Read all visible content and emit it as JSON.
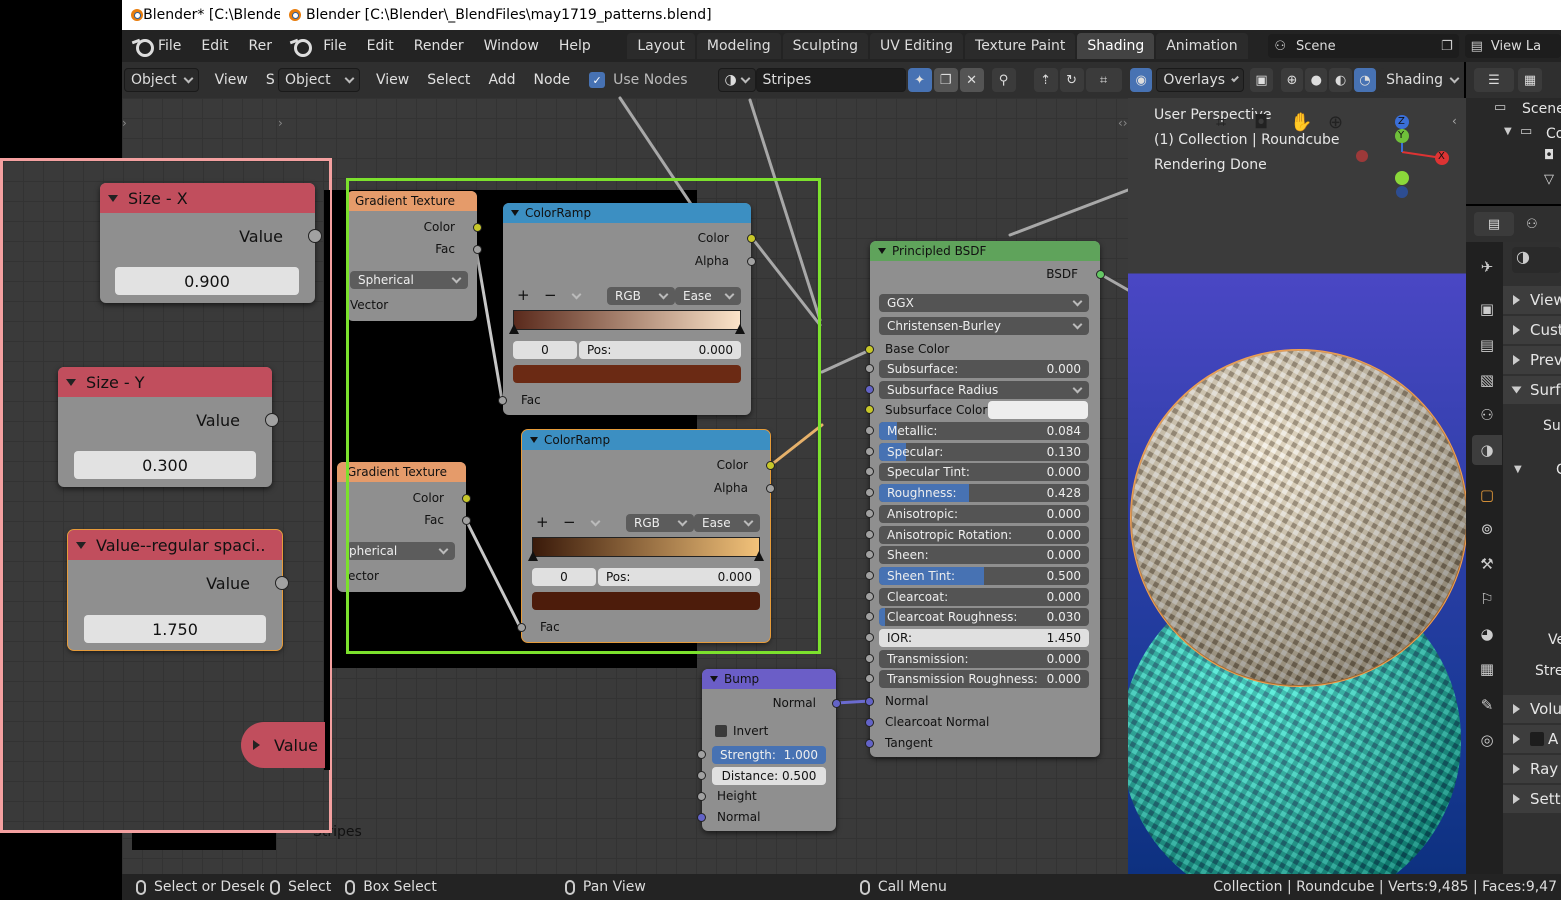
{
  "window": {
    "title_back": "Blender* [C:\\Blende",
    "title_front": "Blender [C:\\Blender\\_BlendFiles\\may1719_patterns.blend]"
  },
  "menu": {
    "back_items": [
      "File",
      "Edit",
      "Rer"
    ],
    "items": [
      "File",
      "Edit",
      "Render",
      "Window",
      "Help"
    ]
  },
  "workspaces": [
    "Layout",
    "Modeling",
    "Sculpting",
    "UV Editing",
    "Texture Paint",
    "Shading",
    "Animation"
  ],
  "active_workspace": "Shading",
  "scene": {
    "name": "Scene",
    "view_layer": "View La"
  },
  "node_header": {
    "back_mode": "Object",
    "back_view": "View",
    "back_s": "S",
    "mode": "Object",
    "items": [
      "View",
      "Select",
      "Add",
      "Node"
    ],
    "use_nodes_label": "Use Nodes",
    "material_name": "Stripes",
    "close_glyph": "✕"
  },
  "viewport": {
    "overlays_label": "Overlays",
    "shading_label": "Shading",
    "info_lines": [
      "User Perspective",
      "(1) Collection | Roundcube",
      "Rendering Done"
    ],
    "axis_z": "Z",
    "axis_y": "Y",
    "axis_x": "X"
  },
  "outliner": {
    "scene": "Scene",
    "collection": "Co"
  },
  "properties": {
    "rows": [
      "View",
      "Cust",
      "Prev",
      "Surfa",
      "Volu",
      "A",
      "Ray",
      "Setti"
    ],
    "partial_labels": [
      "Su",
      "C",
      "Ve",
      "Stre"
    ]
  },
  "nodes": {
    "size_x": {
      "title": "Size - X",
      "output": "Value",
      "value": "0.900"
    },
    "size_y": {
      "title": "Size - Y",
      "output": "Value",
      "value": "0.300"
    },
    "regular": {
      "title": "Value--regular spaci..",
      "output": "Value",
      "value": "1.750"
    },
    "value_collapsed": {
      "title": "Value"
    },
    "gradient1": {
      "title": "Gradient Texture",
      "out_color": "Color",
      "out_fac": "Fac",
      "type": "Spherical",
      "input": "Vector"
    },
    "gradient2": {
      "title": "Gradient Texture",
      "out_color": "Color",
      "out_fac": "Fac",
      "type": "pherical",
      "input": "ector"
    },
    "ramp1": {
      "title": "ColorRamp",
      "out_color": "Color",
      "out_alpha": "Alpha",
      "mode": "RGB",
      "interp": "Ease",
      "index": "0",
      "pos_label": "Pos:",
      "pos_value": "0.000",
      "input": "Fac",
      "ramp_colors": [
        "#5a2a1c",
        "#fbe3c9"
      ],
      "stop_color": "#6b2a14",
      "add": "+",
      "minus": "−"
    },
    "ramp2": {
      "title": "ColorRamp",
      "out_color": "Color",
      "out_alpha": "Alpha",
      "mode": "RGB",
      "interp": "Ease",
      "index": "0",
      "pos_label": "Pos:",
      "pos_value": "0.000",
      "input": "Fac",
      "ramp_colors": [
        "#3a1a0a",
        "#f2c27a"
      ],
      "stop_color": "#4d1c0b",
      "add": "+",
      "minus": "−"
    },
    "bump": {
      "title": "Bump",
      "output": "Normal",
      "invert": "Invert",
      "strength_label": "Strength:",
      "strength": "1.000",
      "distance_label": "Distance:",
      "distance": "0.500",
      "in_height": "Height",
      "in_normal": "Normal"
    },
    "bsdf": {
      "title": "Principled BSDF",
      "output": "BSDF",
      "distribution": "GGX",
      "subsurface_method": "Christensen-Burley",
      "base_color": "Base Color",
      "subsurface_radius": "Subsurface Radius",
      "subsurface_color": "Subsurface Color",
      "fields": [
        {
          "label": "Subsurface:",
          "value": "0.000",
          "fill": 0
        },
        {
          "label": "Metallic:",
          "value": "0.084",
          "fill": 0.084
        },
        {
          "label": "Specular:",
          "value": "0.130",
          "fill": 0.13
        },
        {
          "label": "Specular Tint:",
          "value": "0.000",
          "fill": 0
        },
        {
          "label": "Roughness:",
          "value": "0.428",
          "fill": 0.428
        },
        {
          "label": "Anisotropic:",
          "value": "0.000",
          "fill": 0
        },
        {
          "label": "Anisotropic Rotation:",
          "value": "0.000",
          "fill": 0
        },
        {
          "label": "Sheen:",
          "value": "0.000",
          "fill": 0
        },
        {
          "label": "Sheen Tint:",
          "value": "0.500",
          "fill": 0.5
        },
        {
          "label": "Clearcoat:",
          "value": "0.000",
          "fill": 0
        },
        {
          "label": "Clearcoat Roughness:",
          "value": "0.030",
          "fill": 0.03
        },
        {
          "label": "IOR:",
          "value": "1.450",
          "fill": 0
        },
        {
          "label": "Transmission:",
          "value": "0.000",
          "fill": 0
        },
        {
          "label": "Transmission Roughness:",
          "value": "0.000",
          "fill": 0
        }
      ],
      "in_normal": "Normal",
      "in_clearcoat_normal": "Clearcoat Normal",
      "in_tangent": "Tangent"
    }
  },
  "frame_label": "Stripes",
  "status": {
    "back_select": "Select or Deselect",
    "select": "Select",
    "box_select": "Box Select",
    "pan": "Pan View",
    "call_menu": "Call Menu",
    "stats": "Collection | Roundcube | Verts:9,485 | Faces:9,47"
  },
  "colors": {
    "accent_blue": "#4772b3",
    "frame_green": "#7ce12d",
    "frame_pink": "#f4a0a0",
    "input_header": "#c14e5d",
    "shader_header": "#5fa35b",
    "texture_header": "#e59b6a",
    "converter_header": "#3c8fc2",
    "vector_header": "#6b5ec7"
  }
}
